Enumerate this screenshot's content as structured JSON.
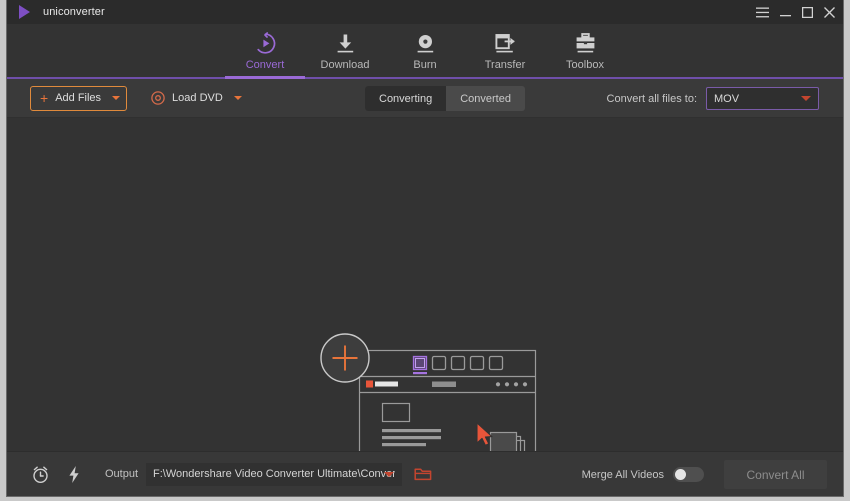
{
  "titlebar": {
    "app_name": "uniconverter",
    "logo_icon": "play-triangle-icon",
    "menu_icon": "hamburger-menu-icon",
    "minimize_icon": "minimize-icon",
    "maximize_icon": "maximize-icon",
    "close_icon": "close-icon"
  },
  "nav": {
    "active_index": 0,
    "accent": "#9a6ad6",
    "items": [
      {
        "label": "Convert",
        "icon": "convert-circle-play-icon"
      },
      {
        "label": "Download",
        "icon": "download-arrow-icon"
      },
      {
        "label": "Burn",
        "icon": "burn-disc-icon"
      },
      {
        "label": "Transfer",
        "icon": "transfer-device-icon"
      },
      {
        "label": "Toolbox",
        "icon": "toolbox-icon"
      }
    ]
  },
  "toolbar": {
    "add_files_label": "Add Files",
    "add_files_icon": "plus-icon",
    "add_files_caret_icon": "chevron-down-icon",
    "add_files_border_color": "#e08a3c",
    "load_dvd_label": "Load DVD",
    "load_dvd_icon": "disc-icon",
    "load_dvd_caret_icon": "chevron-down-icon",
    "tabs": [
      {
        "label": "Converting",
        "active": true
      },
      {
        "label": "Converted",
        "active": false
      }
    ],
    "convert_all_to_label": "Convert all files to:",
    "format_value": "MOV",
    "format_caret_icon": "chevron-down-icon",
    "format_border_color": "#7a5ba8"
  },
  "main": {
    "illustration": {
      "name": "drag-and-drop-add-files-illustration",
      "plus_badge_icon": "plus-circle-icon",
      "plus_color": "#e8743a",
      "window_tab_active_color": "#8b5fc6",
      "cursor_icon": "arrow-cursor-icon",
      "file_stack_icon": "file-stack-icon"
    }
  },
  "bottombar": {
    "alarm_icon": "alarm-clock-icon",
    "speed_icon": "lightning-bolt-icon",
    "output_label": "Output",
    "output_path": "F:\\Wondershare Video Converter Ultimate\\Converted",
    "output_caret_icon": "chevron-down-icon",
    "folder_icon": "open-folder-icon",
    "merge_label": "Merge All Videos",
    "merge_enabled": false,
    "convert_all_label": "Convert All",
    "accent_orange": "#c4452f"
  }
}
